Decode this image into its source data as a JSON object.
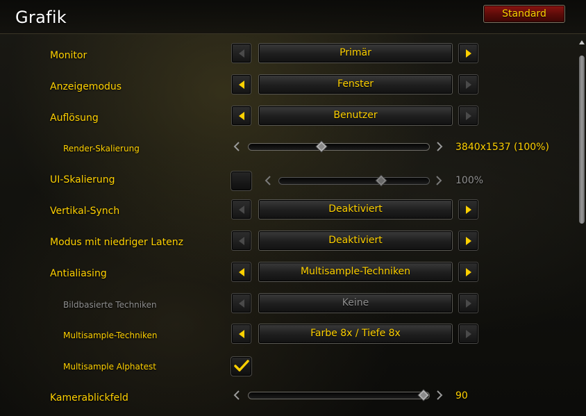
{
  "header": {
    "title": "Grafik",
    "standard_button": "Standard"
  },
  "rows": [
    {
      "label": "Monitor",
      "value": "Primär"
    },
    {
      "label": "Anzeigemodus",
      "value": "Fenster"
    },
    {
      "label": "Auflösung",
      "value": "Benutzer"
    },
    {
      "label": "Render-Skalierung",
      "value": "3840x1537 (100%)",
      "slider_fraction": 0.45
    },
    {
      "label": "UI-Skalierung",
      "value": "100%",
      "slider_fraction": 0.67,
      "checked": false
    },
    {
      "label": "Vertikal-Synch",
      "value": "Deaktiviert"
    },
    {
      "label": "Modus mit niedriger Latenz",
      "value": "Deaktiviert"
    },
    {
      "label": "Antialiasing",
      "value": "Multisample-Techniken"
    },
    {
      "label": "Bildbasierte Techniken",
      "value": "Keine"
    },
    {
      "label": "Multisample-Techniken",
      "value": "Farbe 8x / Tiefe 8x"
    },
    {
      "label": "Multisample Alphatest",
      "checked": true
    },
    {
      "label": "Kamerablickfeld",
      "value": "90",
      "slider_fraction": 0.98
    }
  ],
  "colors": {
    "accent": "#ffd100",
    "disabled": "#8f8f8f",
    "standard_button": "#7a100d"
  },
  "icons": [
    "chevron-left-icon",
    "chevron-right-icon",
    "checkmark-icon",
    "slider-diamond-icon",
    "scroll-up-icon"
  ]
}
